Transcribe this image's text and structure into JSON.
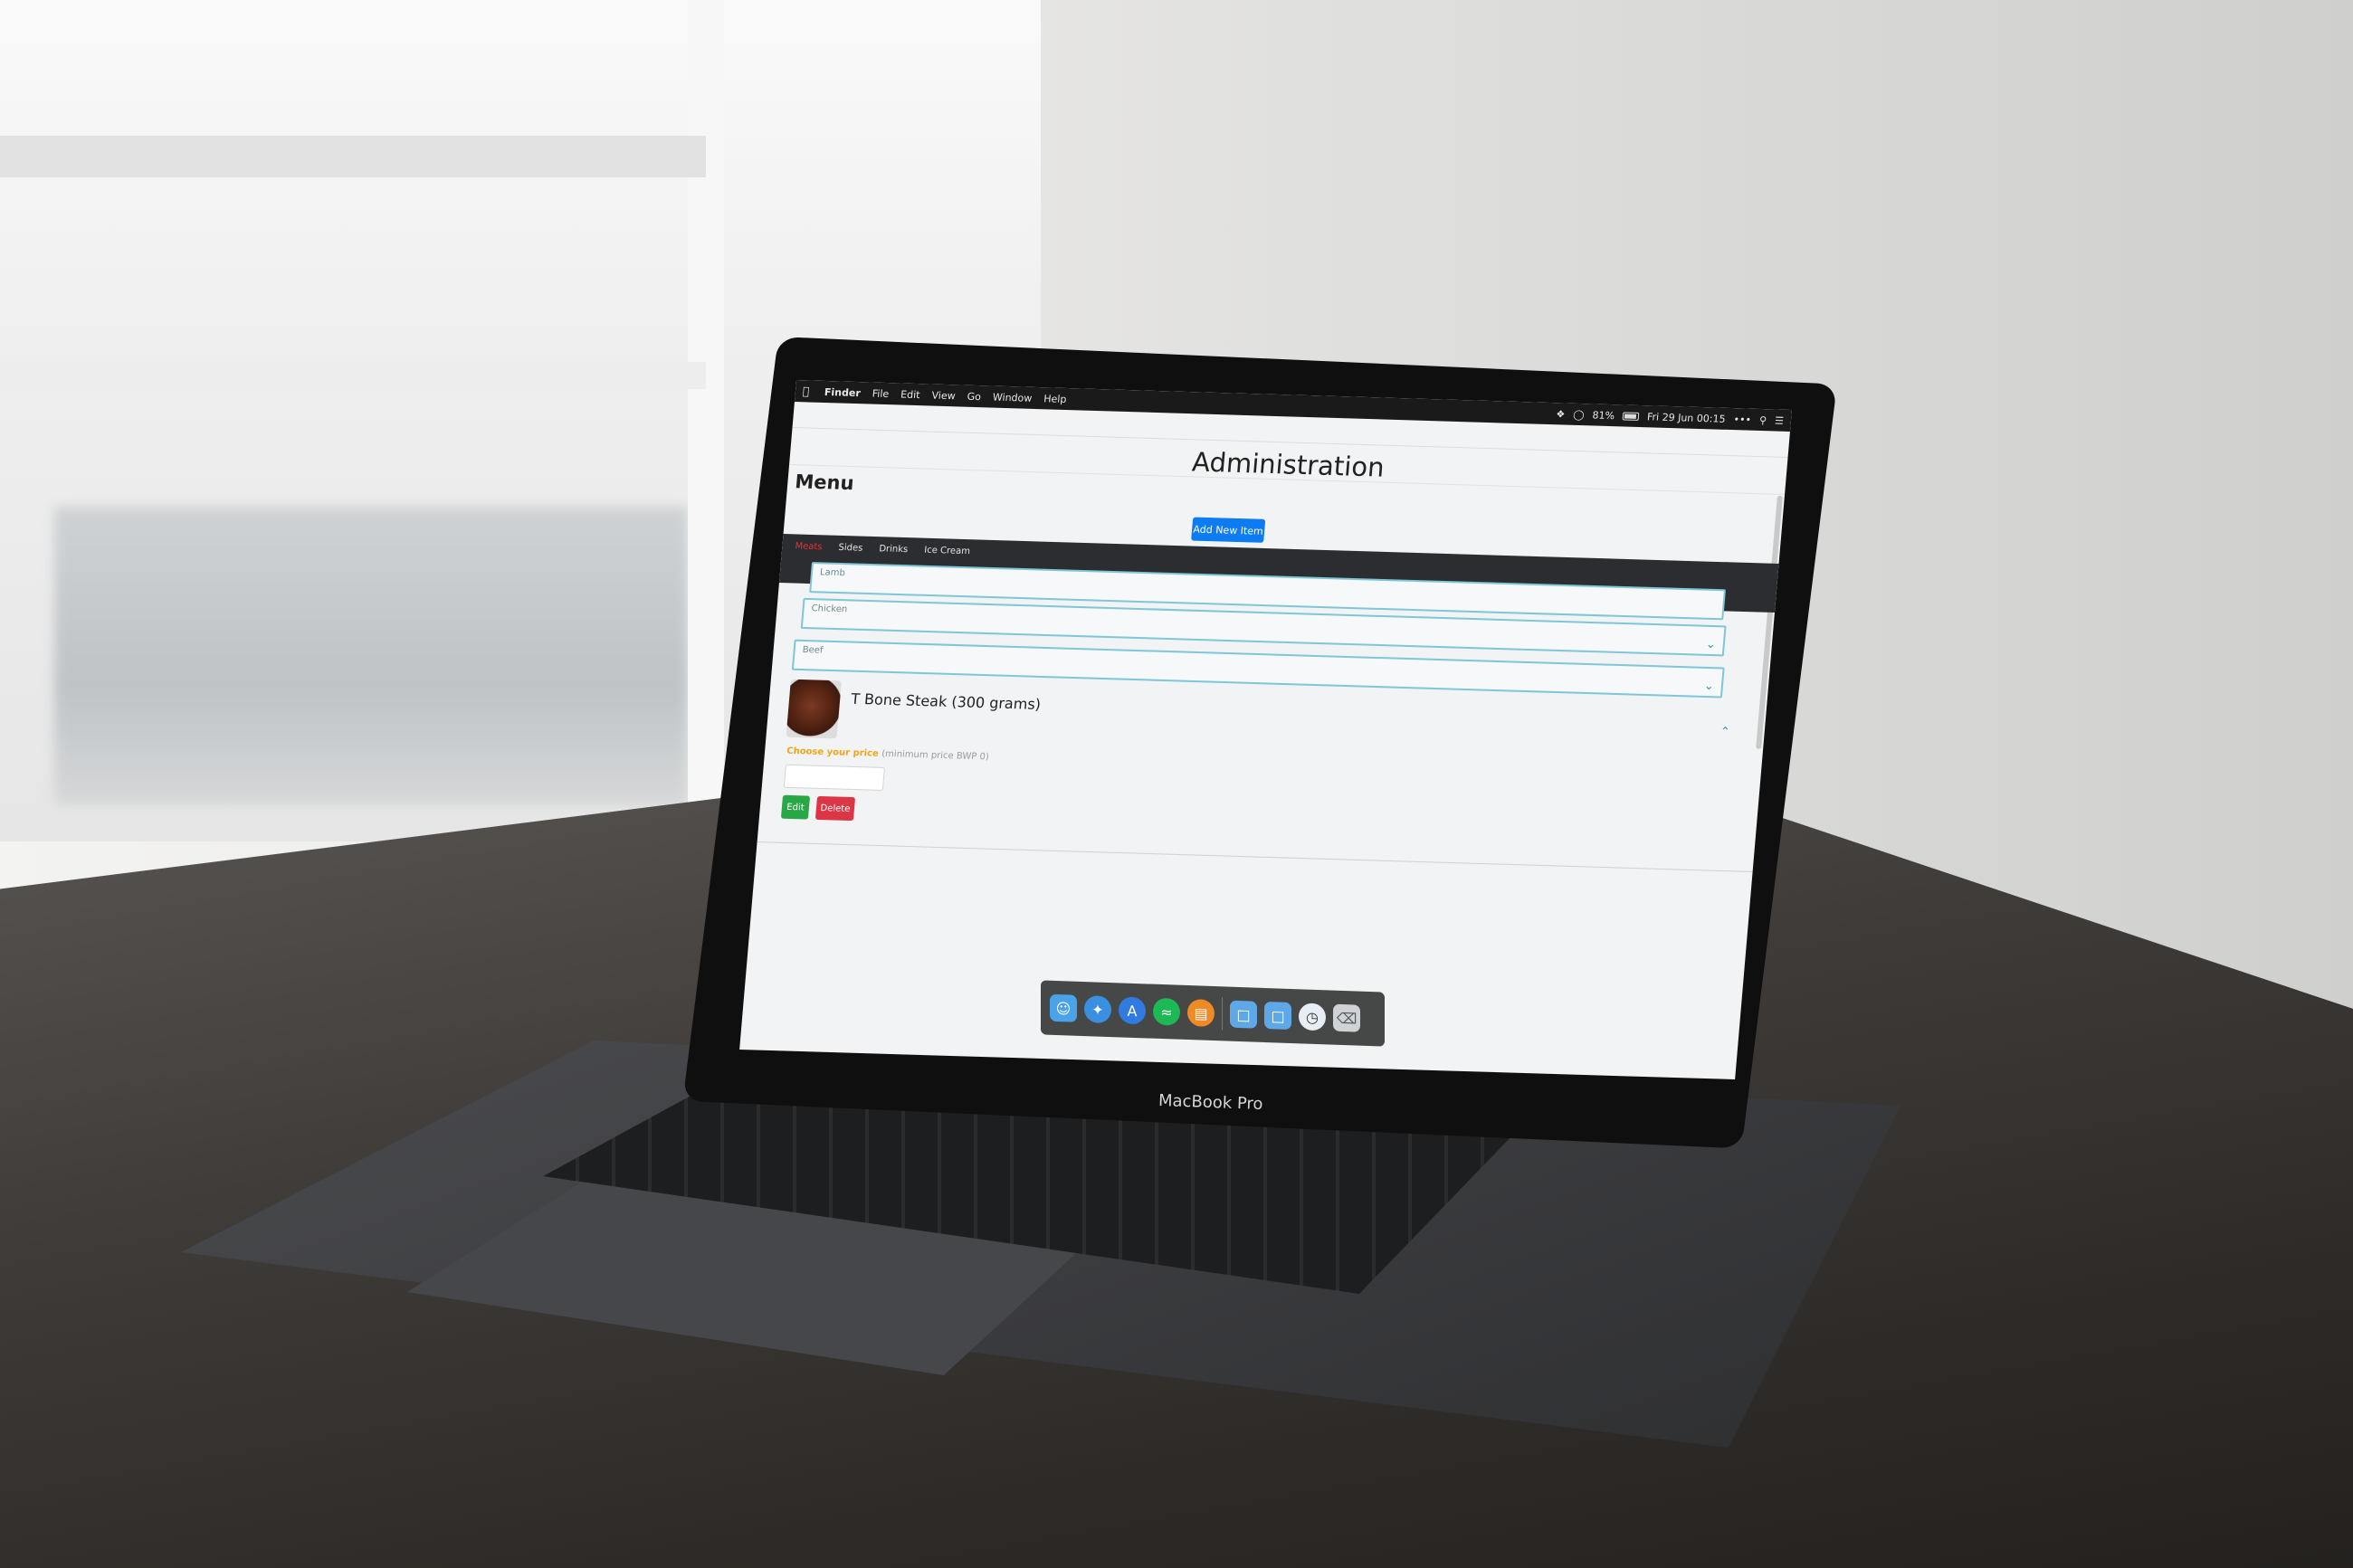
{
  "menubar": {
    "app_name": "Finder",
    "items": [
      "File",
      "Edit",
      "View",
      "Go",
      "Window",
      "Help"
    ],
    "battery_percent": "81%",
    "datetime": "Fri 29 Jun  00:15",
    "more": "•••"
  },
  "page": {
    "title": "Administration",
    "section_heading": "Menu",
    "add_button_label": "Add New Item"
  },
  "nav": {
    "tabs": [
      {
        "label": "Meats",
        "active": true
      },
      {
        "label": "Sides",
        "active": false
      },
      {
        "label": "Drinks",
        "active": false
      },
      {
        "label": "Ice Cream",
        "active": false
      }
    ]
  },
  "categories": [
    {
      "label": "Lamb"
    },
    {
      "label": "Chicken"
    },
    {
      "label": "Beef"
    }
  ],
  "item": {
    "name": "T Bone Steak (300 grams)",
    "price_prompt": "Choose your price",
    "price_hint": "(minimum price BWP 0)",
    "price_value": "",
    "edit_label": "Edit",
    "delete_label": "Delete"
  },
  "dock": {
    "apps": [
      "finder-icon",
      "safari-icon",
      "app-store-icon",
      "spotify-icon",
      "books-icon",
      "folder-icon",
      "folder-icon",
      "time-machine-icon",
      "trash-icon"
    ]
  },
  "device": {
    "brand": "MacBook Pro"
  },
  "colors": {
    "accent_blue": "#0d7cf2",
    "active_tab_red": "#e2333b",
    "category_border": "#7fc6d6",
    "price_prompt": "#f1a51c",
    "edit_green": "#28a745",
    "delete_red": "#dc3545",
    "navbar_dark": "#2b2d30"
  }
}
